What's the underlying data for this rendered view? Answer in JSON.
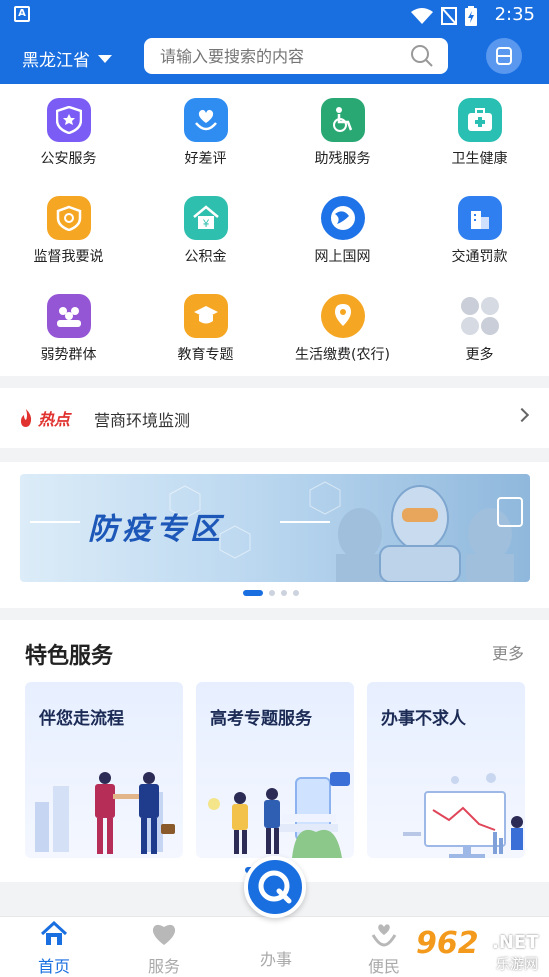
{
  "status_bar": {
    "time": "2:35",
    "app_badge": "A"
  },
  "header": {
    "province": "黑龙江省",
    "search_placeholder": "请输入要搜索的内容"
  },
  "services": [
    {
      "label": "公安服务",
      "icon": "police-shield-icon",
      "color": "#7b5cf5"
    },
    {
      "label": "好差评",
      "icon": "heart-hand-icon",
      "color": "#2f8df2"
    },
    {
      "label": "助残服务",
      "icon": "wheelchair-icon",
      "color": "#2aa874"
    },
    {
      "label": "卫生健康",
      "icon": "medical-kit-icon",
      "color": "#29bfb3"
    },
    {
      "label": "监督我要说",
      "icon": "supervise-icon",
      "color": "#f5a623"
    },
    {
      "label": "公积金",
      "icon": "housing-fund-icon",
      "color": "#2fbfae"
    },
    {
      "label": "网上国网",
      "icon": "state-grid-icon",
      "color": "#1e73e8"
    },
    {
      "label": "交通罚款",
      "icon": "building-icon",
      "color": "#2f7ff0"
    },
    {
      "label": "弱势群体",
      "icon": "people-group-icon",
      "color": "#9556d6"
    },
    {
      "label": "教育专题",
      "icon": "graduation-cap-icon",
      "color": "#f5a623"
    },
    {
      "label": "生活缴费(农行)",
      "icon": "location-pin-icon",
      "color": "#f5a623"
    },
    {
      "label": "更多",
      "icon": "more-grid-icon",
      "color": "#c9ced8"
    }
  ],
  "hot": {
    "tag": "热点",
    "text": "营商环境监测"
  },
  "banner": {
    "title": "防疫专区",
    "slide_count": 4,
    "active_index": 0
  },
  "feature": {
    "title": "特色服务",
    "more": "更多",
    "cards": [
      {
        "title": "伴您走流程"
      },
      {
        "title": "高考专题服务"
      },
      {
        "title": "办事不求人"
      }
    ]
  },
  "tabbar": {
    "tabs": [
      "首页",
      "服务",
      "办事",
      "便民"
    ],
    "active": "首页"
  },
  "watermark": {
    "num": "962",
    "net": ".NET",
    "sub": "乐游网"
  },
  "colors": {
    "primary": "#1a6fe0",
    "hot": "#e0322f"
  }
}
